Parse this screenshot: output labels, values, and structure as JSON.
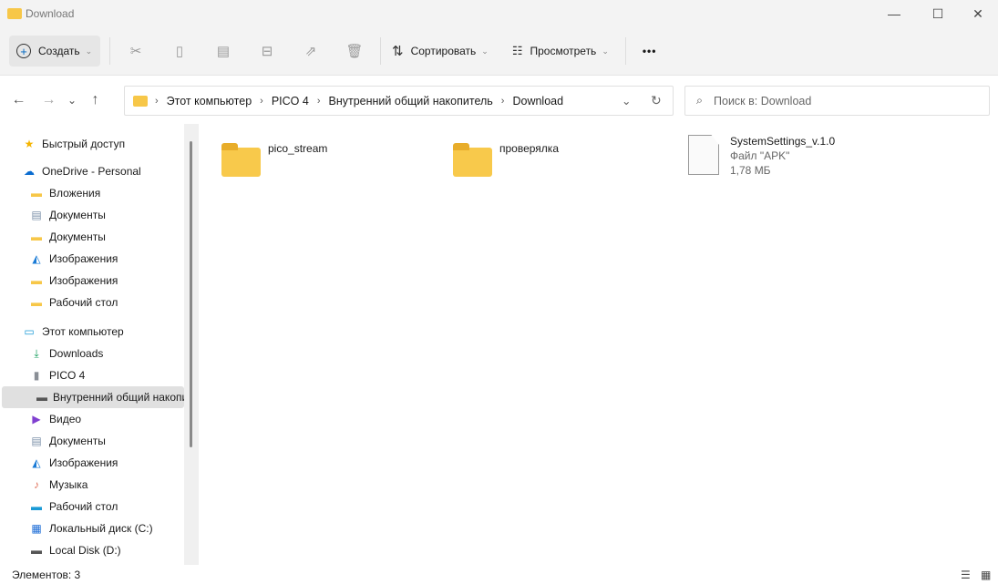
{
  "window": {
    "title": "Download",
    "minimize": "—",
    "maximize": "☐",
    "close": "✕"
  },
  "toolbar": {
    "create": "Создать",
    "sort": "Сортировать",
    "view": "Просмотреть",
    "more": "•••",
    "icons": [
      "cut-icon",
      "copy-icon",
      "paste-icon",
      "rename-icon",
      "share-icon",
      "delete-icon"
    ]
  },
  "nav": {
    "back": "←",
    "forward": "→",
    "recent": "⌄",
    "up": "↑",
    "breadcrumb": [
      "Этот компьютер",
      "PICO 4",
      "Внутренний общий накопитель",
      "Download"
    ],
    "search_placeholder": "Поиск в: Download"
  },
  "sidebar": {
    "items": [
      {
        "label": "Быстрый доступ",
        "icon": "star-icon",
        "level": 0
      },
      {
        "label": "OneDrive - Personal",
        "icon": "cloud-icon",
        "level": 0
      },
      {
        "label": "Вложения",
        "icon": "folder-icon",
        "level": 1
      },
      {
        "label": "Документы",
        "icon": "document-icon",
        "level": 1
      },
      {
        "label": "Документы",
        "icon": "folder-icon",
        "level": 1
      },
      {
        "label": "Изображения",
        "icon": "pictures-icon",
        "level": 1
      },
      {
        "label": "Изображения",
        "icon": "folder-icon",
        "level": 1
      },
      {
        "label": "Рабочий стол",
        "icon": "folder-icon",
        "level": 1
      },
      {
        "label": "Этот компьютер",
        "icon": "monitor-icon",
        "level": 0
      },
      {
        "label": "Downloads",
        "icon": "download-icon",
        "level": 1
      },
      {
        "label": "PICO 4",
        "icon": "device-icon",
        "level": 1
      },
      {
        "label": "Внутренний общий накопитель",
        "icon": "drive-icon",
        "level": 2,
        "selected": true
      },
      {
        "label": "Видео",
        "icon": "video-icon",
        "level": 1
      },
      {
        "label": "Документы",
        "icon": "document-icon",
        "level": 1
      },
      {
        "label": "Изображения",
        "icon": "pictures-icon",
        "level": 1
      },
      {
        "label": "Музыка",
        "icon": "music-icon",
        "level": 1
      },
      {
        "label": "Рабочий стол",
        "icon": "desktop-icon",
        "level": 1
      },
      {
        "label": "Локальный диск (C:)",
        "icon": "windows-drive-icon",
        "level": 1
      },
      {
        "label": "Local Disk (D:)",
        "icon": "drive-icon",
        "level": 1
      }
    ]
  },
  "files": [
    {
      "name": "pico_stream",
      "type": "folder"
    },
    {
      "name": "проверялка",
      "type": "folder"
    },
    {
      "name": "SystemSettings_v.1.0",
      "type": "file",
      "kind": "Файл \"APK\"",
      "size": "1,78 МБ"
    }
  ],
  "status": {
    "count": "Элементов: 3"
  }
}
